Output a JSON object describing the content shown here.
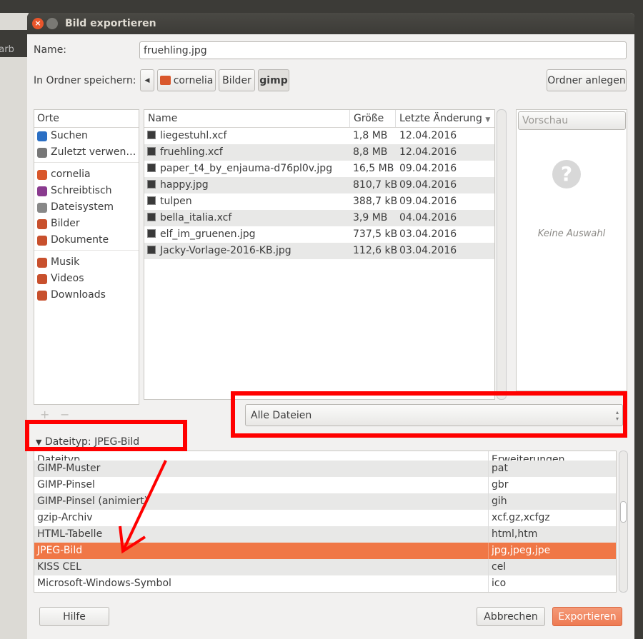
{
  "background": {
    "title_fragment": "Farb"
  },
  "dialog": {
    "title": "Bild exportieren"
  },
  "name": {
    "label": "Name:",
    "value": "fruehling.jpg"
  },
  "folder": {
    "label": "In Ordner speichern:",
    "crumbs": [
      "cornelia",
      "Bilder",
      "gimp"
    ],
    "create_folder": "Ordner anlegen"
  },
  "places": {
    "header": "Orte",
    "items": [
      {
        "label": "Suchen",
        "icon": "search-icon"
      },
      {
        "label": "Zuletzt verwen…",
        "icon": "clock-icon"
      },
      {
        "label": "cornelia",
        "icon": "home-folder-icon"
      },
      {
        "label": "Schreibtisch",
        "icon": "desktop-icon"
      },
      {
        "label": "Dateisystem",
        "icon": "drive-icon"
      },
      {
        "label": "Bilder",
        "icon": "folder-icon"
      },
      {
        "label": "Dokumente",
        "icon": "folder-icon"
      },
      {
        "label": "Musik",
        "icon": "music-icon"
      },
      {
        "label": "Videos",
        "icon": "video-icon"
      },
      {
        "label": "Downloads",
        "icon": "folder-icon"
      }
    ],
    "add": "+",
    "remove": "−"
  },
  "files": {
    "columns": [
      "Name",
      "Größe",
      "Letzte Änderung"
    ],
    "rows": [
      [
        "liegestuhl.xcf",
        "1,8 MB",
        "12.04.2016"
      ],
      [
        "fruehling.xcf",
        "8,8 MB",
        "12.04.2016"
      ],
      [
        "paper_t4_by_enjauma-d76pl0v.jpg",
        "16,5 MB",
        "09.04.2016"
      ],
      [
        "happy.jpg",
        "810,7 kB",
        "09.04.2016"
      ],
      [
        "tulpen",
        "388,7 kB",
        "09.04.2016"
      ],
      [
        "bella_italia.xcf",
        "3,9 MB",
        "04.04.2016"
      ],
      [
        "elf_im_gruenen.jpg",
        "737,5 kB",
        "03.04.2016"
      ],
      [
        "Jacky-Vorlage-2016-KB.jpg",
        "112,6 kB",
        "03.04.2016"
      ]
    ]
  },
  "preview": {
    "button": "Vorschau",
    "empty": "Keine Auswahl"
  },
  "filter": {
    "selected": "Alle Dateien"
  },
  "filetype": {
    "expander": "Dateityp: JPEG-Bild",
    "columns": [
      "Dateityp",
      "Erweiterungen"
    ],
    "rows": [
      [
        "GIMP-Muster",
        "pat"
      ],
      [
        "GIMP-Pinsel",
        "gbr"
      ],
      [
        "GIMP-Pinsel (animiert)",
        "gih"
      ],
      [
        "gzip-Archiv",
        "xcf.gz,xcfgz"
      ],
      [
        "HTML-Tabelle",
        "html,htm"
      ],
      [
        "JPEG-Bild",
        "jpg,jpeg,jpe"
      ],
      [
        "KISS CEL",
        "cel"
      ],
      [
        "Microsoft-Windows-Symbol",
        "ico"
      ]
    ],
    "selected": "JPEG-Bild"
  },
  "buttons": {
    "help": "Hilfe",
    "cancel": "Abbrechen",
    "export": "Exportieren"
  },
  "colors": {
    "accent": "#f07746",
    "annotation": "#ff0000"
  }
}
